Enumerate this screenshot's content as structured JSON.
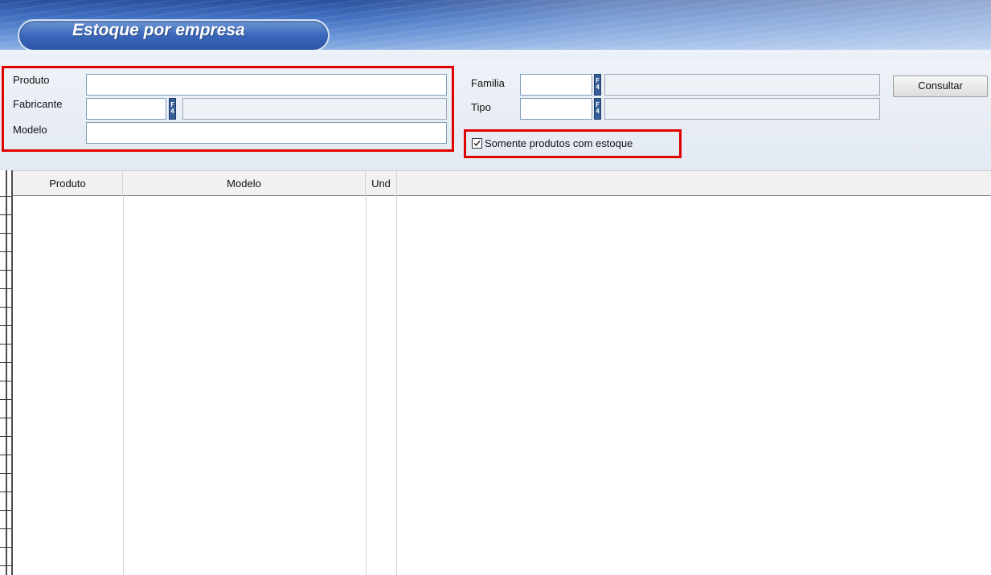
{
  "header": {
    "title": "Estoque por empresa"
  },
  "filters": {
    "produto_label": "Produto",
    "fabricante_label": "Fabricante",
    "modelo_label": "Modelo",
    "familia_label": "Familia",
    "tipo_label": "Tipo",
    "produto_value": "",
    "fabricante_code": "",
    "fabricante_desc": "",
    "modelo_value": "",
    "familia_code": "",
    "familia_desc": "",
    "tipo_code": "",
    "tipo_desc": "",
    "lookup_key": "F4",
    "stock_only_label": "Somente produtos com estoque",
    "stock_only_checked": true,
    "consult_button": "Consultar"
  },
  "grid": {
    "columns": [
      "Produto",
      "Modelo",
      "Und"
    ],
    "rows": []
  },
  "colors": {
    "highlight": "#e00000",
    "banner": "#3b68bb"
  },
  "icons": {
    "lookup": "f4-lookup-icon",
    "check": "check-icon"
  }
}
